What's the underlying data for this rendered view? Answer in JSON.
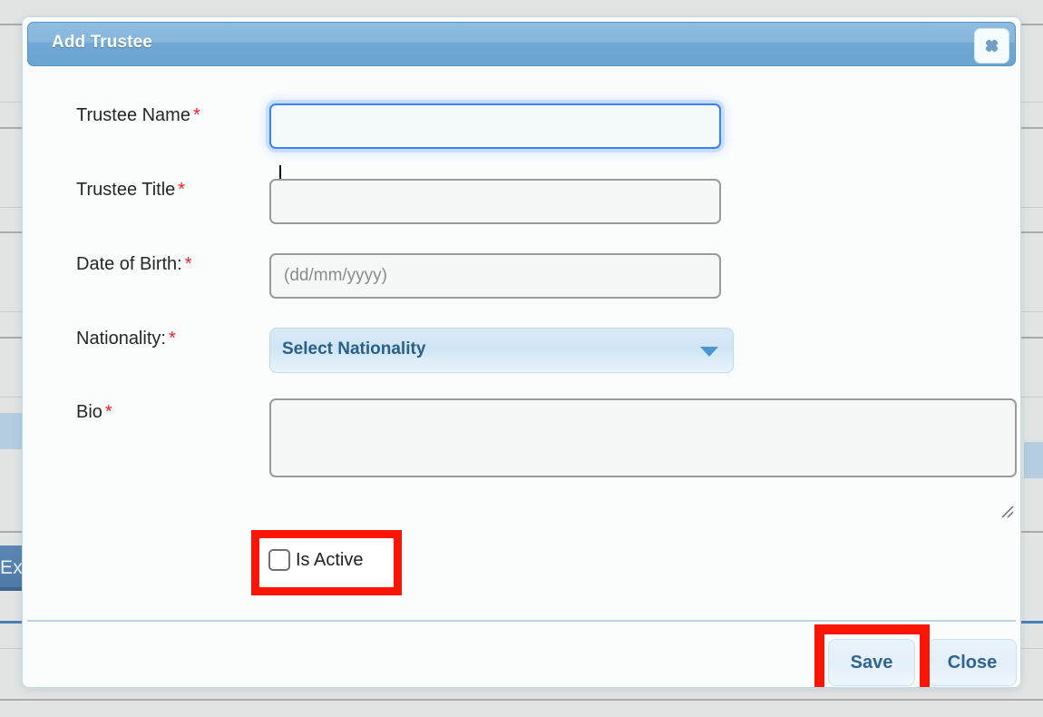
{
  "background": {
    "export_button_label": "Ex"
  },
  "modal": {
    "title": "Add Trustee",
    "close_icon": "close-x-icon",
    "fields": [
      {
        "label": "Trustee Name",
        "required_marker": "*",
        "value": "",
        "placeholder": ""
      },
      {
        "label": "Trustee Title",
        "required_marker": "*",
        "value": "",
        "placeholder": ""
      },
      {
        "label": "Date of Birth:",
        "required_marker": "*",
        "value": "",
        "placeholder": "(dd/mm/yyyy)"
      },
      {
        "label": "Nationality:",
        "required_marker": "*",
        "selected_option": "Select Nationality",
        "dropdown_icon": "chevron-down-icon"
      },
      {
        "label": "Bio",
        "required_marker": "*",
        "value": "",
        "placeholder": ""
      }
    ],
    "checkbox": {
      "label": "Is Active",
      "checked": false
    },
    "footer": {
      "save_label": "Save",
      "close_label": "Close"
    }
  },
  "annotations": {
    "color": "#fb1505",
    "highlighted": [
      "is-active-checkbox",
      "save-button"
    ]
  }
}
